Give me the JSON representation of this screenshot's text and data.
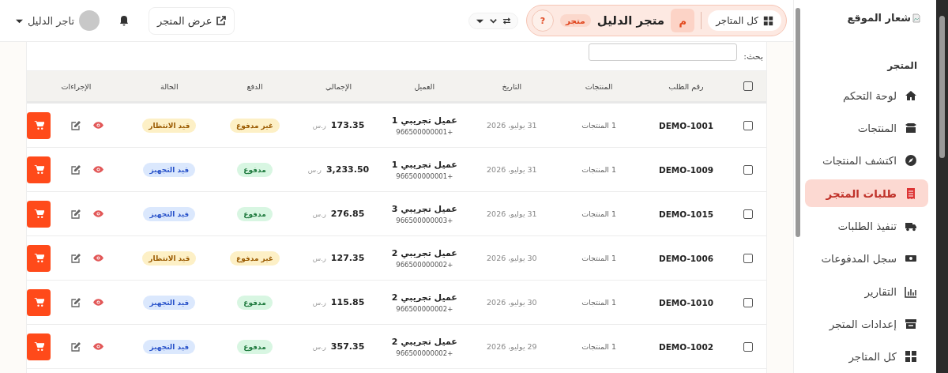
{
  "topbar": {
    "user": "تاجر الدليل",
    "view_store": "عرض المتجر",
    "store_switcher": {
      "all_stores": "كل المتاجر",
      "avatar": "م",
      "store_name": "متجر الدليل",
      "badge": "متجر",
      "help": "?"
    }
  },
  "table": {
    "search_label": "بحث:",
    "select_all": false,
    "columns": [
      "رقم الطلب",
      "المنتجات",
      "التاريخ",
      "العميل",
      "الإجمالي",
      "الدفع",
      "الحالة",
      "الإجراءات"
    ],
    "rows": [
      {
        "selected": false,
        "order": "DEMO-1001",
        "products": "1 المنتجات",
        "date": "31 يوليو، 2026",
        "customer": "عميل تجريبي 1",
        "phone": "+966500000001",
        "total": "173.35",
        "currency": "ر.س",
        "payment": {
          "label": "غير مدفوع",
          "kind": "unpaid"
        },
        "status": {
          "label": "قيد الانتظار",
          "kind": "pending"
        }
      },
      {
        "selected": false,
        "order": "DEMO-1009",
        "products": "1 المنتجات",
        "date": "31 يوليو، 2026",
        "customer": "عميل تجريبي 1",
        "phone": "+966500000001",
        "total": "3,233.50",
        "currency": "ر.س",
        "payment": {
          "label": "مدفوع",
          "kind": "paid"
        },
        "status": {
          "label": "قيد التجهيز",
          "kind": "processing"
        }
      },
      {
        "selected": false,
        "order": "DEMO-1015",
        "products": "1 المنتجات",
        "date": "31 يوليو، 2026",
        "customer": "عميل تجريبي 3",
        "phone": "+966500000003",
        "total": "276.85",
        "currency": "ر.س",
        "payment": {
          "label": "مدفوع",
          "kind": "paid"
        },
        "status": {
          "label": "قيد التجهيز",
          "kind": "processing"
        }
      },
      {
        "selected": false,
        "order": "DEMO-1006",
        "products": "1 المنتجات",
        "date": "30 يوليو، 2026",
        "customer": "عميل تجريبي 2",
        "phone": "+966500000002",
        "total": "127.35",
        "currency": "ر.س",
        "payment": {
          "label": "غير مدفوع",
          "kind": "unpaid"
        },
        "status": {
          "label": "قيد الانتظار",
          "kind": "pending"
        }
      },
      {
        "selected": false,
        "order": "DEMO-1010",
        "products": "1 المنتجات",
        "date": "30 يوليو، 2026",
        "customer": "عميل تجريبي 2",
        "phone": "+966500000002",
        "total": "115.85",
        "currency": "ر.س",
        "payment": {
          "label": "مدفوع",
          "kind": "paid"
        },
        "status": {
          "label": "قيد التجهيز",
          "kind": "processing"
        }
      },
      {
        "selected": false,
        "order": "DEMO-1002",
        "products": "1 المنتجات",
        "date": "29 يوليو، 2026",
        "customer": "عميل تجريبي 2",
        "phone": "+966500000002",
        "total": "357.35",
        "currency": "ر.س",
        "payment": {
          "label": "مدفوع",
          "kind": "paid"
        },
        "status": {
          "label": "قيد التجهيز",
          "kind": "processing"
        }
      }
    ]
  },
  "sidebar": {
    "logo": "شعار الموقع",
    "section": "المتجر",
    "items": [
      {
        "label": "لوحة التحكم",
        "selected": false
      },
      {
        "label": "المنتجات",
        "selected": false
      },
      {
        "label": "اكتشف المنتجات",
        "selected": false
      },
      {
        "label": "طلبات المتجر",
        "selected": true
      },
      {
        "label": "تنفيذ الطلبات",
        "selected": false
      },
      {
        "label": "سجل المدفوعات",
        "selected": false
      },
      {
        "label": "التقارير",
        "selected": false
      },
      {
        "label": "إعدادات المتجر",
        "selected": false
      },
      {
        "label": "كل المتاجر",
        "selected": false
      }
    ]
  }
}
